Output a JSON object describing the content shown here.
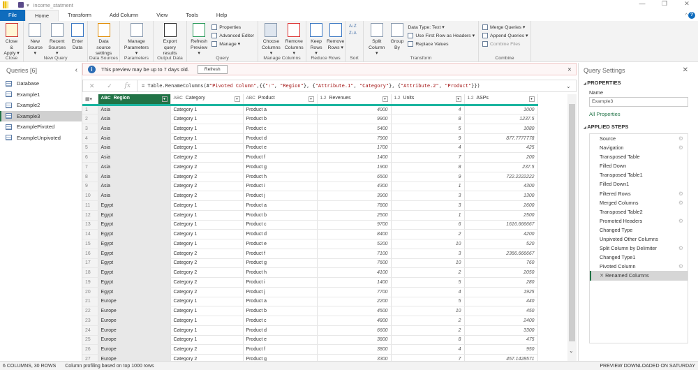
{
  "title": "income_statment",
  "window": {
    "minimize": "—",
    "restore": "❐",
    "close": "✕",
    "help": "?"
  },
  "tabs": [
    "File",
    "Home",
    "Transform",
    "Add Column",
    "View",
    "Tools",
    "Help"
  ],
  "ribbon": {
    "close": {
      "close_apply": "Close & Apply ▾",
      "group": "Close"
    },
    "new_query": {
      "new_source": "New Source ▾",
      "recent_sources": "Recent Sources ▾",
      "enter_data": "Enter Data",
      "group": "New Query"
    },
    "data_sources": {
      "settings": "Data source settings",
      "group": "Data Sources"
    },
    "parameters": {
      "manage": "Manage Parameters ▾",
      "group": "Parameters"
    },
    "output": {
      "export": "Export query results",
      "group": "Output Data"
    },
    "query": {
      "refresh": "Refresh Preview ▾",
      "properties": "Properties",
      "advanced_editor": "Advanced Editor",
      "manage": "Manage ▾",
      "group": "Query"
    },
    "manage_columns": {
      "choose": "Choose Columns ▾",
      "remove": "Remove Columns ▾",
      "group": "Manage Columns"
    },
    "reduce_rows": {
      "keep": "Keep Rows ▾",
      "remove": "Remove Rows ▾",
      "group": "Reduce Rows"
    },
    "sort": {
      "asc": "A↓Z",
      "desc": "Z↓A",
      "group": "Sort"
    },
    "transform": {
      "split": "Split Column ▾",
      "group_by": "Group By",
      "data_type": "Data Type: Text ▾",
      "first_row": "Use First Row as Headers ▾",
      "replace": "Replace Values",
      "group": "Transform"
    },
    "combine": {
      "merge": "Merge Queries ▾",
      "append": "Append Queries ▾",
      "combine_files": "Combine Files",
      "group": "Combine"
    }
  },
  "queries": {
    "title": "Queries [6]",
    "items": [
      "Database",
      "Example1",
      "Example2",
      "Example3",
      "ExamplePivoted",
      "ExampleUnpivoted"
    ],
    "selected": 3
  },
  "notice": {
    "text": "This preview may be up to 7 days old.",
    "button": "Refresh"
  },
  "formula": {
    "prefix": "= Table.RenameColumns(#",
    "s1": "\"Pivoted Column\"",
    "mid1": ",{{",
    "s2": "\":\"",
    "c1": ", ",
    "s3": "\"Region\"",
    "m2": "}, {",
    "s4": "\"Attribute.1\"",
    "c2": ", ",
    "s5": "\"Category\"",
    "m3": "}, {",
    "s6": "\"Attribute.2\"",
    "c3": ", ",
    "s7": "\"Product\"",
    "end": "}})"
  },
  "columns": [
    {
      "type": "ABC",
      "name": "Region"
    },
    {
      "type": "ABC",
      "name": "Category"
    },
    {
      "type": "ABC",
      "name": "Product"
    },
    {
      "type": "1.2",
      "name": "Revenues"
    },
    {
      "type": "1.2",
      "name": "Units"
    },
    {
      "type": "1.2",
      "name": "ASPs"
    }
  ],
  "rows": [
    [
      "Asia",
      "Category 1",
      "Product a",
      "4000",
      "4",
      "1000"
    ],
    [
      "Asia",
      "Category 1",
      "Product b",
      "9900",
      "8",
      "1237.5"
    ],
    [
      "Asia",
      "Category 1",
      "Product c",
      "5400",
      "5",
      "1080"
    ],
    [
      "Asia",
      "Category 1",
      "Product d",
      "7900",
      "9",
      "877.7777778"
    ],
    [
      "Asia",
      "Category 1",
      "Product e",
      "1700",
      "4",
      "425"
    ],
    [
      "Asia",
      "Category 2",
      "Product f",
      "1400",
      "7",
      "200"
    ],
    [
      "Asia",
      "Category 2",
      "Product g",
      "1900",
      "8",
      "237.5"
    ],
    [
      "Asia",
      "Category 2",
      "Product h",
      "6500",
      "9",
      "722.2222222"
    ],
    [
      "Asia",
      "Category 2",
      "Product i",
      "4300",
      "1",
      "4300"
    ],
    [
      "Asia",
      "Category 2",
      "Product j",
      "3900",
      "3",
      "1300"
    ],
    [
      "Egypt",
      "Category 1",
      "Product a",
      "7800",
      "3",
      "2600"
    ],
    [
      "Egypt",
      "Category 1",
      "Product b",
      "2500",
      "1",
      "2500"
    ],
    [
      "Egypt",
      "Category 1",
      "Product c",
      "9700",
      "6",
      "1616.666667"
    ],
    [
      "Egypt",
      "Category 1",
      "Product d",
      "8400",
      "2",
      "4200"
    ],
    [
      "Egypt",
      "Category 1",
      "Product e",
      "5200",
      "10",
      "520"
    ],
    [
      "Egypt",
      "Category 2",
      "Product f",
      "7100",
      "3",
      "2366.666667"
    ],
    [
      "Egypt",
      "Category 2",
      "Product g",
      "7600",
      "10",
      "760"
    ],
    [
      "Egypt",
      "Category 2",
      "Product h",
      "4100",
      "2",
      "2050"
    ],
    [
      "Egypt",
      "Category 2",
      "Product i",
      "1400",
      "5",
      "280"
    ],
    [
      "Egypt",
      "Category 2",
      "Product j",
      "7700",
      "4",
      "1925"
    ],
    [
      "Europe",
      "Category 1",
      "Product a",
      "2200",
      "5",
      "440"
    ],
    [
      "Europe",
      "Category 1",
      "Product b",
      "4500",
      "10",
      "450"
    ],
    [
      "Europe",
      "Category 1",
      "Product c",
      "4800",
      "2",
      "2400"
    ],
    [
      "Europe",
      "Category 1",
      "Product d",
      "6600",
      "2",
      "3300"
    ],
    [
      "Europe",
      "Category 1",
      "Product e",
      "3800",
      "8",
      "475"
    ],
    [
      "Europe",
      "Category 2",
      "Product f",
      "3800",
      "4",
      "950"
    ],
    [
      "Europe",
      "Category 2",
      "Product g",
      "3300",
      "7",
      "457.1428571"
    ]
  ],
  "settings": {
    "title": "Query Settings",
    "properties": "PROPERTIES",
    "name_label": "Name",
    "name_value": "Example3",
    "all_properties": "All Properties",
    "applied_steps": "APPLIED STEPS",
    "steps": [
      {
        "name": "Source",
        "gear": true
      },
      {
        "name": "Navigation",
        "gear": true
      },
      {
        "name": "Transposed Table"
      },
      {
        "name": "Filled Down"
      },
      {
        "name": "Transposed Table1"
      },
      {
        "name": "Filled Down1"
      },
      {
        "name": "Filtered Rows",
        "gear": true
      },
      {
        "name": "Merged Columns",
        "gear": true
      },
      {
        "name": "Transposed Table2"
      },
      {
        "name": "Promoted Headers",
        "gear": true
      },
      {
        "name": "Changed Type"
      },
      {
        "name": "Unpivoted Other Columns"
      },
      {
        "name": "Split Column by Delimiter",
        "gear": true
      },
      {
        "name": "Changed Type1"
      },
      {
        "name": "Pivoted Column",
        "gear": true
      },
      {
        "name": "Renamed Columns",
        "selected": true
      }
    ]
  },
  "status": {
    "columns": "6 COLUMNS, 30 ROWS",
    "profiling": "Column profiling based on top 1000 rows",
    "preview": "PREVIEW DOWNLOADED ON SATURDAY"
  }
}
